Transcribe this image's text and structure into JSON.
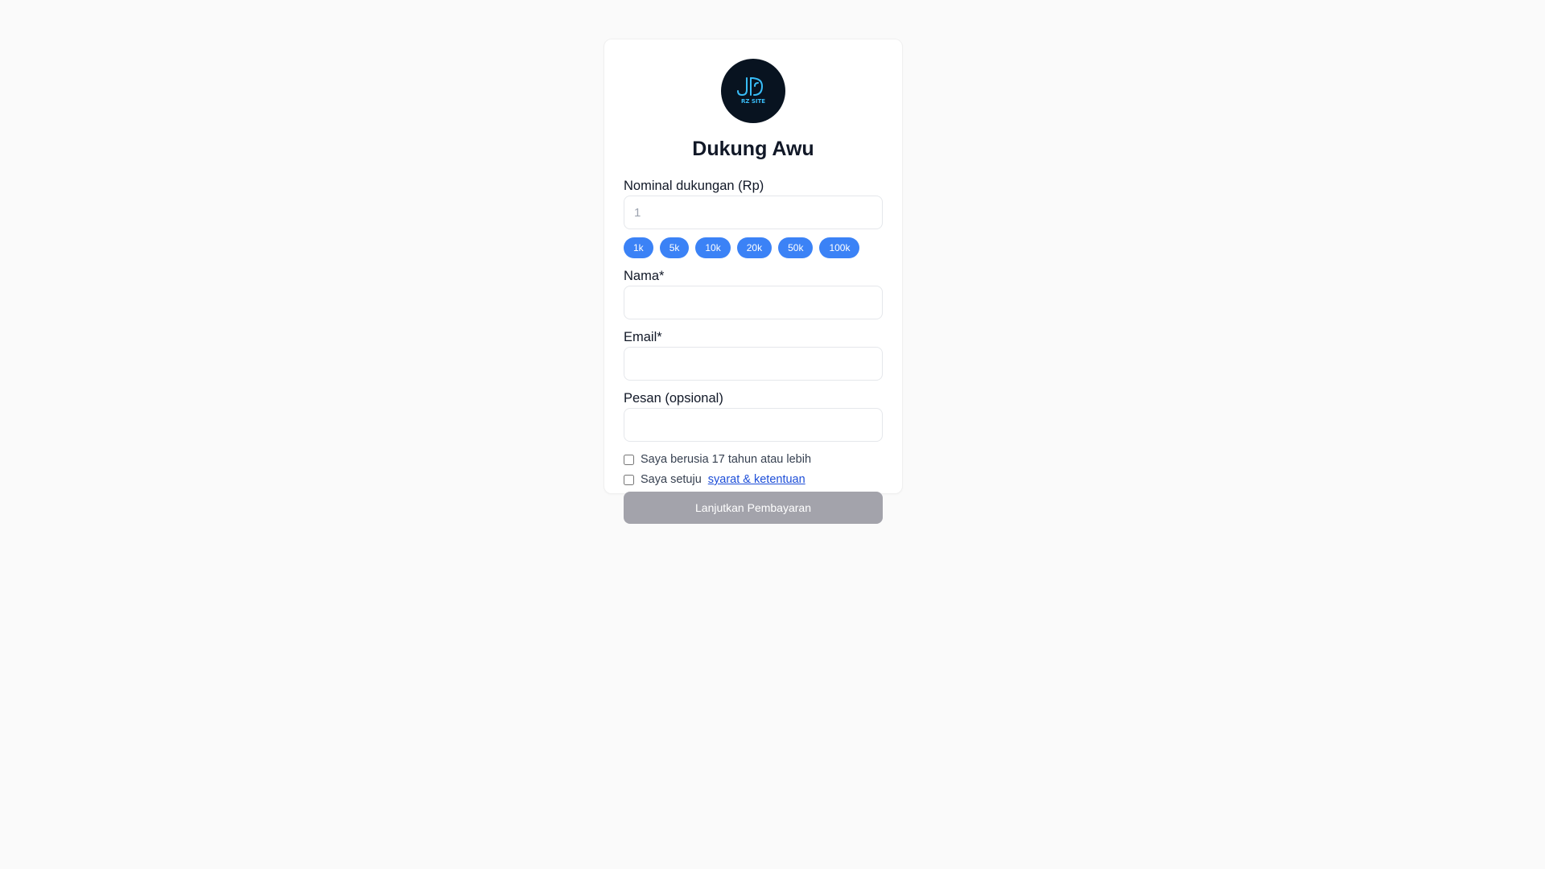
{
  "header": {
    "logo_icon": "rz-site-logo",
    "logo_text": "RZ SITE",
    "title": "Dukung Awu"
  },
  "form": {
    "amount": {
      "label": "Nominal dukungan (Rp)",
      "placeholder": "1",
      "value": ""
    },
    "presets": [
      "1k",
      "5k",
      "10k",
      "20k",
      "50k",
      "100k"
    ],
    "name": {
      "label": "Nama*",
      "value": ""
    },
    "email": {
      "label": "Email*",
      "value": ""
    },
    "message": {
      "label": "Pesan (opsional)",
      "value": ""
    },
    "age_check": {
      "label": "Saya berusia 17 tahun atau lebih",
      "checked": false
    },
    "terms_check": {
      "label": "Saya setuju",
      "link_text": "syarat & ketentuan",
      "checked": false
    },
    "submit_label": "Lanjutkan Pembayaran"
  },
  "colors": {
    "background": "#fafafa",
    "card": "#ffffff",
    "chip": "#3b82f6",
    "submit_disabled": "#a3a3ab",
    "link": "#1d4ed8",
    "logo_bg": "#081320",
    "logo_accent": "#38bdf8"
  }
}
